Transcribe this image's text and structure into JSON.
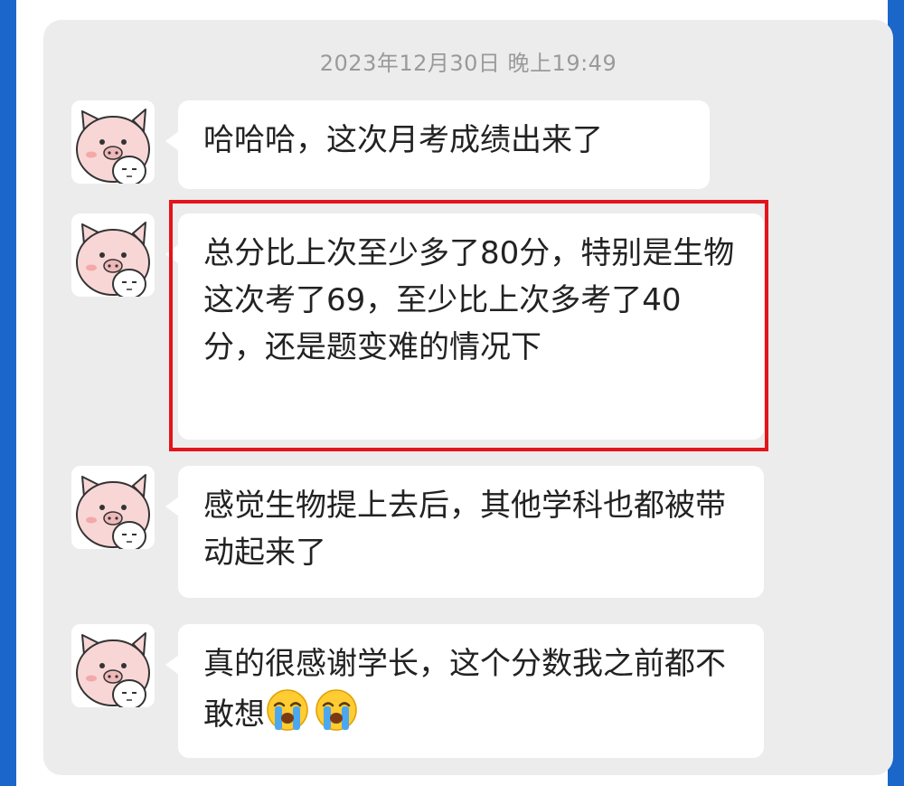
{
  "chat": {
    "timestamp": "2023年12月30日 晚上19:49",
    "messages": [
      {
        "text": "哈哈哈，这次月考成绩出来了"
      },
      {
        "text": "总分比上次至少多了80分，特别是生物这次考了69，至少比上次多考了40分，还是题变难的情况下",
        "highlighted": true
      },
      {
        "text": "感觉生物提上去后，其他学科也都被带动起来了"
      },
      {
        "text": "真的很感谢学长，这个分数我之前都不敢想",
        "emoji_count": 2,
        "emoji": "loudly-crying-face-icon"
      }
    ]
  },
  "colors": {
    "background": "#1a66c9",
    "chat_area": "#ececec",
    "bubble": "#ffffff",
    "highlight": "#e3141b",
    "avatar_pig": "#f8d6d6"
  }
}
